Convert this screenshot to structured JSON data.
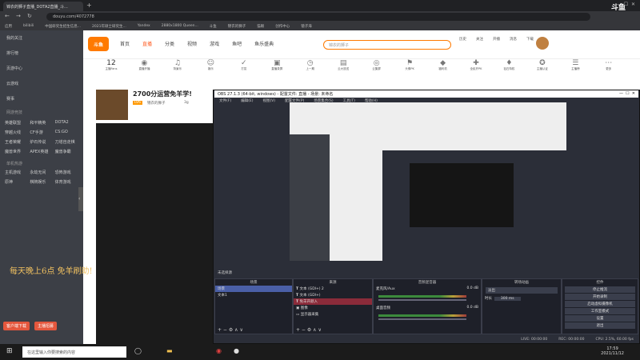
{
  "browser": {
    "tab_title": "锦衣的狮子直播_DOTA2直播_斗...",
    "url": "douyu.com/4072778",
    "bookmarks": [
      "应用",
      "bilibili",
      "中国研究生招生信息...",
      "2021年硕士研究生...",
      "Yandex",
      "2880x1800 Queen...",
      "斗鱼",
      "锦衣的狮子",
      "猫眼",
      "创作中心",
      "镜子海"
    ]
  },
  "sidebar": {
    "items": [
      "我的关注",
      "排行榜",
      "页游中心",
      "云游戏",
      "赛事"
    ],
    "section_title": "网游竞技",
    "games": [
      "英雄联盟",
      "和平精英",
      "DOTA2",
      "穿越火线",
      "CF手游",
      "CS:GO",
      "王者荣耀",
      "炉石传说",
      "刀塔自走棋",
      "魔兽世界",
      "APEX英雄",
      "魔兽争霸"
    ],
    "section2_title": "单机热游",
    "games2": [
      "主机游戏",
      "永劫无间",
      "恐怖游戏",
      "原神",
      "棋牌娱乐",
      "体育游戏"
    ],
    "buttons": [
      "客户端下载",
      "主播招募"
    ]
  },
  "header": {
    "nav": [
      "首页",
      "直播",
      "分类",
      "视频",
      "游戏",
      "鱼吧",
      "鱼乐盛典"
    ],
    "search_placeholder": "锦衣的狮子",
    "right_items": [
      "历史",
      "关注",
      "开播",
      "消息",
      "下载"
    ]
  },
  "toolbar": {
    "count": "12",
    "labels": [
      "主播Fans",
      "直播开播",
      "背景乐",
      "娱乐",
      "打赏",
      "直播录屏",
      "上一期",
      "云大放送",
      "云集屏",
      "头像PK",
      "福利机",
      "全民开PK",
      "钻石特权",
      "主播认证",
      "主播榜",
      "更多"
    ]
  },
  "room": {
    "title": "2700分运营免羊学!",
    "streamer": "锦衣的狮子",
    "followers": "3g",
    "level": "LV6"
  },
  "obs": {
    "title": "OBS 27.1.3 (64-bit, windows) - 配置文件: 直播 - 场景: 未命名",
    "menu": [
      "文件(F)",
      "编辑(E)",
      "视图(V)",
      "配置文件(P)",
      "场景集合(S)",
      "工具(T)",
      "帮助(H)"
    ],
    "source_label": "未选择源",
    "panels": {
      "scenes": "场景",
      "sources": "来源",
      "mixer": "音频混音器",
      "transitions": "转场动画",
      "controls": "控件"
    },
    "scenes": [
      "场景",
      "文本1"
    ],
    "sources": [
      "文本 (GDI+) 2",
      "文本 (GDI+)",
      "免羊开颜入",
      "图像",
      "显示器采集"
    ],
    "mixer": [
      {
        "name": "麦克风/Aux",
        "db": "0.0 dB"
      },
      {
        "name": "桌面音频",
        "db": "0.0 dB"
      }
    ],
    "transition": {
      "type": "淡出",
      "duration_label": "时长",
      "duration": "300 ms"
    },
    "controls": [
      "停止推流",
      "开始录制",
      "启动虚拟摄像机",
      "工作室模式",
      "设置",
      "退出"
    ],
    "status": [
      "LIVE: 00:00:00",
      "REC: 00:00:00",
      "CPU: 2.5%, 60.00 fps"
    ]
  },
  "overlay_text": "每天晚上6点 免羊刷助!",
  "watermark": "斗鱼",
  "taskbar": {
    "search_placeholder": "在这里输入你要搜索的内容",
    "time": "17:59",
    "date": "2021/11/12"
  }
}
